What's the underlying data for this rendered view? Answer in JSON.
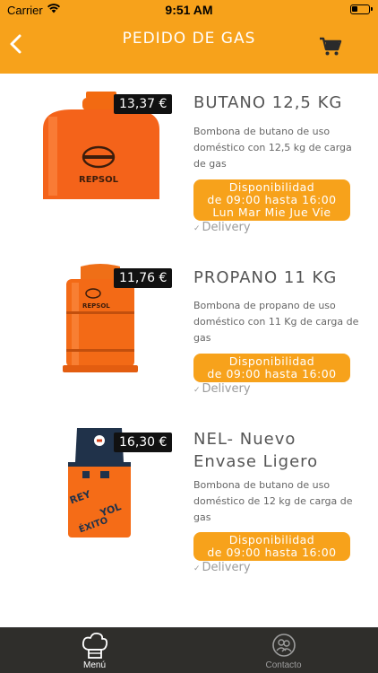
{
  "status_bar": {
    "carrier": "Carrier",
    "time": "9:51 AM"
  },
  "header": {
    "title": "PEDIDO DE GAS",
    "back_icon": "chevron-left-icon",
    "cart_icon": "cart-icon"
  },
  "products": [
    {
      "price": "13,37 €",
      "name_line1": "BUTANO 12,5 KG",
      "name_line2": "",
      "desc_line1": "Bombona de butano de uso",
      "desc_line2": "doméstico con 12,5 kg de carga",
      "desc_line3": "de gas",
      "avail_line1": "Disponibilidad",
      "avail_line2": "de 09:00 hasta 16:00",
      "avail_line3": "Lun Mar Mie Jue Vie",
      "delivery": "Delivery"
    },
    {
      "price": "11,76 €",
      "name_line1": "PROPANO 11 KG",
      "name_line2": "",
      "desc_line1": "Bombona de propano de uso",
      "desc_line2": "doméstico con 11 Kg de carga de",
      "desc_line3": "gas",
      "avail_line1": "Disponibilidad",
      "avail_line2": "de 09:00 hasta 16:00",
      "avail_line3": "",
      "delivery": "Delivery"
    },
    {
      "price": "16,30 €",
      "name_line1": "NEL- Nuevo",
      "name_line2": "Envase Ligero",
      "desc_line1": "Bombona de butano de uso",
      "desc_line2": "doméstico de 12 kg de carga de",
      "desc_line3": "gas",
      "avail_line1": "Disponibilidad",
      "avail_line2": "de 09:00 hasta 16:00",
      "avail_line3": "",
      "delivery": "Delivery"
    }
  ],
  "tabbar": {
    "menu": {
      "label": "Menú",
      "icon": "chef-hat-icon"
    },
    "contacto": {
      "label": "Contacto",
      "icon": "contacts-icon"
    }
  },
  "colors": {
    "accent": "#f7a21b",
    "tabbar": "#2f2e2b",
    "price_badge": "#111111"
  }
}
